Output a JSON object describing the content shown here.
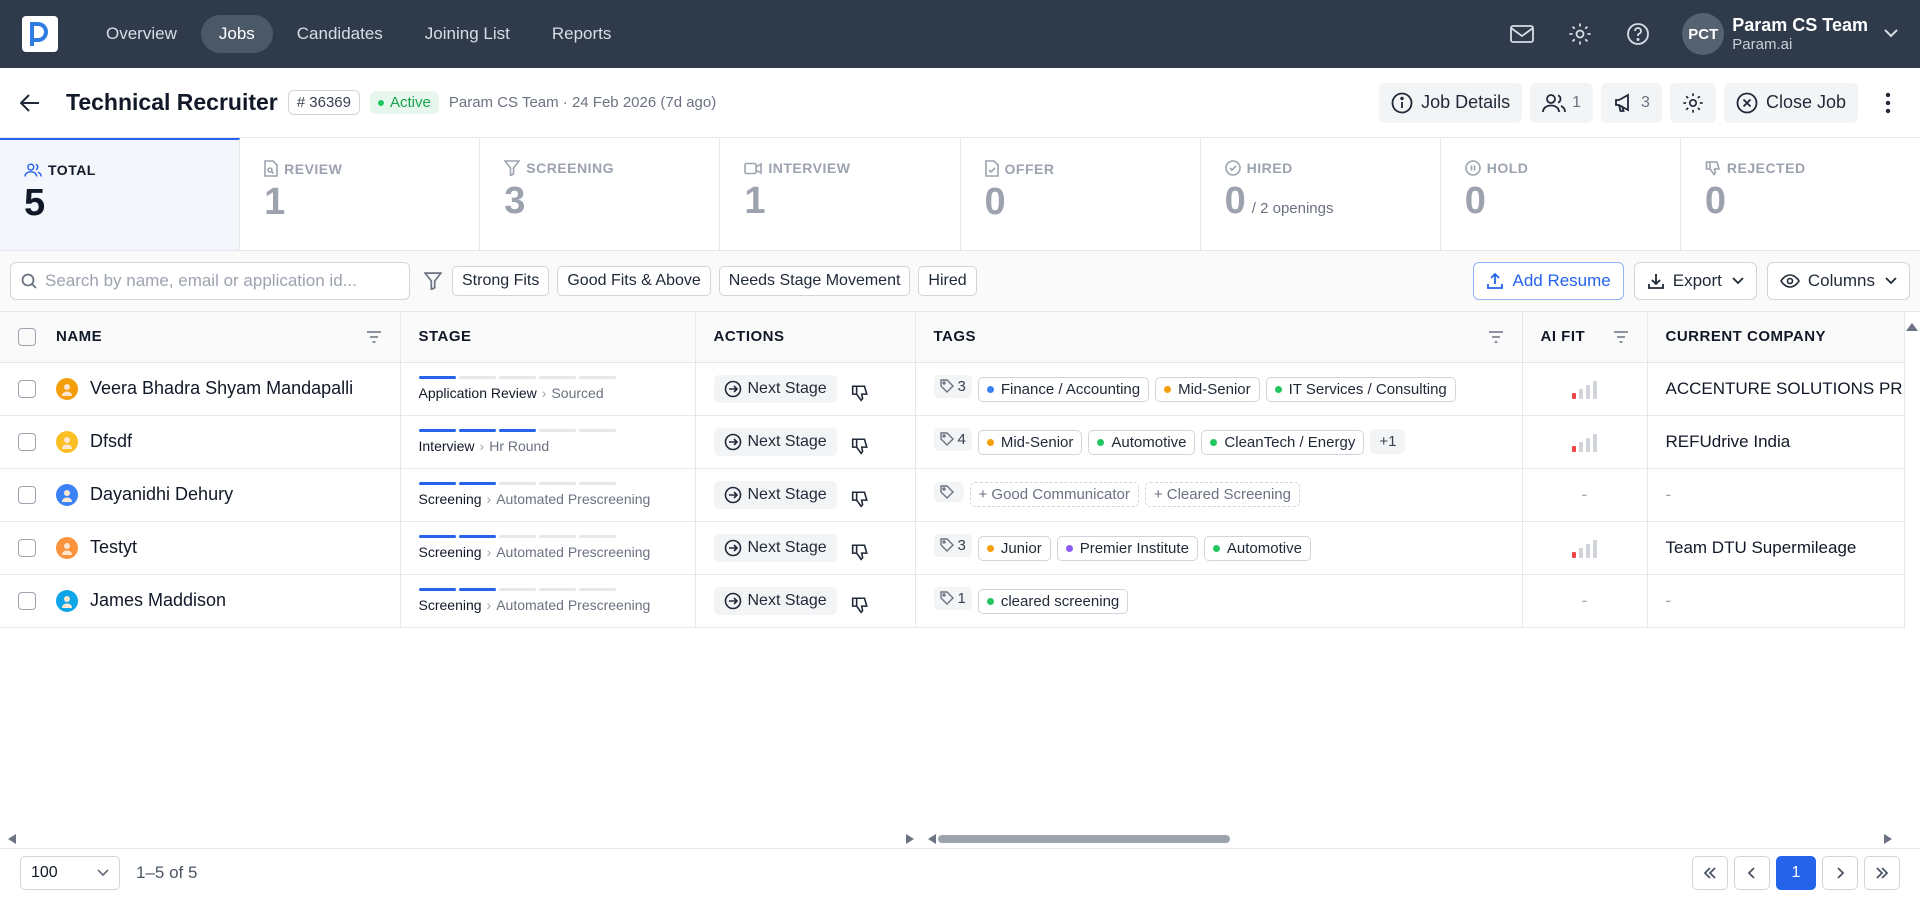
{
  "nav": {
    "tabs": [
      "Overview",
      "Jobs",
      "Candidates",
      "Joining List",
      "Reports"
    ],
    "active_tab": "Jobs",
    "user": {
      "initials": "PCT",
      "name": "Param CS Team",
      "org": "Param.ai"
    }
  },
  "job": {
    "title": "Technical Recruiter",
    "id": "# 36369",
    "status": "Active",
    "meta": "Param CS Team · 24 Feb 2026 (7d ago)",
    "job_details_label": "Job Details",
    "team_count": "1",
    "announce_count": "3",
    "close_label": "Close Job"
  },
  "stages": [
    {
      "label": "TOTAL",
      "count": "5",
      "sub": ""
    },
    {
      "label": "REVIEW",
      "count": "1",
      "sub": ""
    },
    {
      "label": "SCREENING",
      "count": "3",
      "sub": ""
    },
    {
      "label": "INTERVIEW",
      "count": "1",
      "sub": ""
    },
    {
      "label": "OFFER",
      "count": "0",
      "sub": ""
    },
    {
      "label": "HIRED",
      "count": "0",
      "sub": "/ 2 openings"
    },
    {
      "label": "HOLD",
      "count": "0",
      "sub": ""
    },
    {
      "label": "REJECTED",
      "count": "0",
      "sub": ""
    }
  ],
  "filters": {
    "search_placeholder": "Search by name, email or application id...",
    "chips": [
      "Strong Fits",
      "Good Fits & Above",
      "Needs Stage Movement",
      "Hired"
    ],
    "add_resume": "Add Resume",
    "export": "Export",
    "columns": "Columns"
  },
  "table": {
    "headers": {
      "name": "NAME",
      "stage": "STAGE",
      "actions": "ACTIONS",
      "tags": "TAGS",
      "ai_fit": "AI FIT",
      "company": "CURRENT COMPANY"
    },
    "next_stage_label": "Next Stage",
    "rows": [
      {
        "name": "Veera Bhadra Shyam Mandapalli",
        "stage": "Application Review",
        "substage": "Sourced",
        "progress": 1,
        "tag_count": "3",
        "tags": [
          {
            "text": "Finance / Accounting",
            "color": "#3b82f6"
          },
          {
            "text": "Mid-Senior",
            "color": "#f59e0b"
          },
          {
            "text": "IT Services / Consulting",
            "color": "#22c55e"
          }
        ],
        "extra": "",
        "ai_fit": 1,
        "company": "ACCENTURE SOLUTIONS PRIVATE LIMITED"
      },
      {
        "name": "Dfsdf",
        "stage": "Interview",
        "substage": "Hr Round",
        "progress": 3,
        "tag_count": "4",
        "tags": [
          {
            "text": "Mid-Senior",
            "color": "#f59e0b"
          },
          {
            "text": "Automotive",
            "color": "#22c55e"
          },
          {
            "text": "CleanTech / Energy",
            "color": "#22c55e"
          }
        ],
        "extra": "+1",
        "ai_fit": 1,
        "company": "REFUdrive India"
      },
      {
        "name": "Dayanidhi Dehury",
        "stage": "Screening",
        "substage": "Automated Prescreening",
        "progress": 2,
        "tag_count": "",
        "tags": [],
        "suggested": [
          "+ Good Communicator",
          "+ Cleared Screening"
        ],
        "extra": "",
        "ai_fit": null,
        "ai_fit_text": "-",
        "company": "-"
      },
      {
        "name": "Testyt",
        "stage": "Screening",
        "substage": "Automated Prescreening",
        "progress": 2,
        "tag_count": "3",
        "tags": [
          {
            "text": "Junior",
            "color": "#f59e0b"
          },
          {
            "text": "Premier Institute",
            "color": "#8b5cf6"
          },
          {
            "text": "Automotive",
            "color": "#22c55e"
          }
        ],
        "extra": "",
        "ai_fit": 1,
        "company": "Team DTU Supermileage"
      },
      {
        "name": "James Maddison",
        "stage": "Screening",
        "substage": "Automated Prescreening",
        "progress": 2,
        "tag_count": "1",
        "tags": [
          {
            "text": "cleared screening",
            "color": "#22c55e"
          }
        ],
        "extra": "",
        "ai_fit": null,
        "ai_fit_text": "-",
        "company": "-"
      }
    ]
  },
  "footer": {
    "page_size": "100",
    "range": "1–5 of 5",
    "current_page": "1"
  }
}
